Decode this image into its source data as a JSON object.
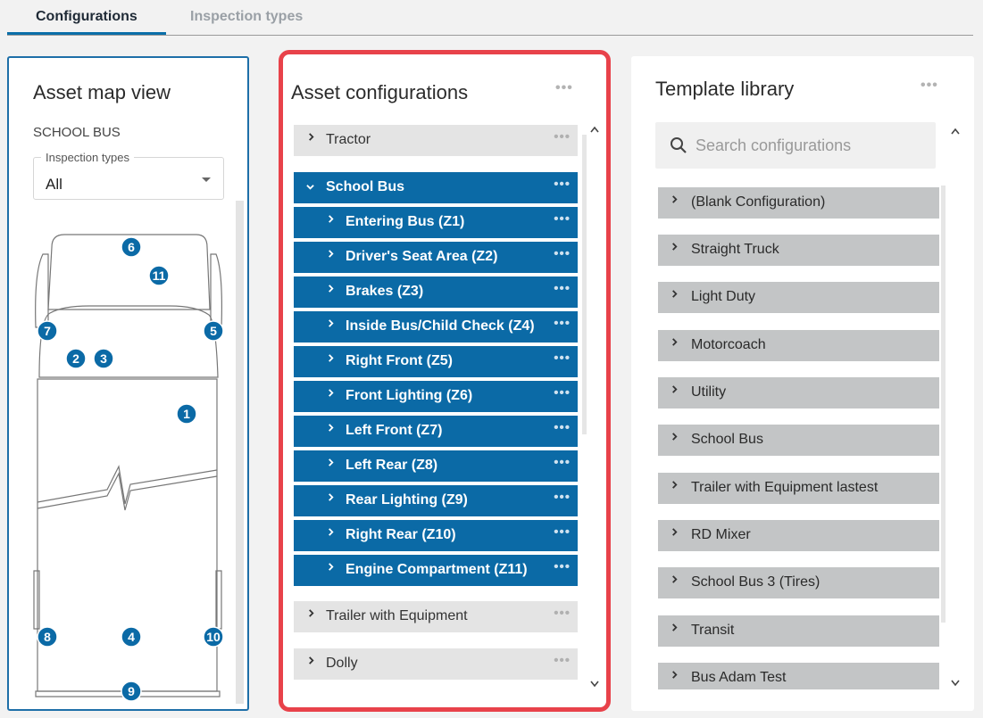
{
  "tabs": [
    {
      "label": "Configurations",
      "active": true
    },
    {
      "label": "Inspection types",
      "active": false
    }
  ],
  "map_view": {
    "title": "Asset map view",
    "asset_name": "SCHOOL BUS",
    "filter": {
      "label": "Inspection types",
      "value": "All"
    },
    "zones": [
      "6",
      "11",
      "7",
      "5",
      "2",
      "3",
      "1",
      "8",
      "4",
      "10",
      "9"
    ]
  },
  "asset_configurations": {
    "title": "Asset configurations",
    "menu_icon": "more-dots-icon",
    "items": [
      {
        "label": "Tractor",
        "expanded": false
      },
      {
        "label": "School Bus",
        "expanded": true,
        "children": [
          {
            "label": "Entering Bus (Z1)"
          },
          {
            "label": "Driver's Seat Area (Z2)"
          },
          {
            "label": "Brakes (Z3)"
          },
          {
            "label": "Inside Bus/Child Check (Z4)"
          },
          {
            "label": "Right Front (Z5)"
          },
          {
            "label": "Front Lighting (Z6)"
          },
          {
            "label": "Left Front (Z7)"
          },
          {
            "label": "Left Rear (Z8)"
          },
          {
            "label": "Rear Lighting (Z9)"
          },
          {
            "label": "Right Rear (Z10)"
          },
          {
            "label": "Engine Compartment (Z11)"
          }
        ]
      },
      {
        "label": "Trailer with Equipment",
        "expanded": false
      },
      {
        "label": "Dolly",
        "expanded": false
      }
    ]
  },
  "template_library": {
    "title": "Template library",
    "search_placeholder": "Search configurations",
    "items": [
      "(Blank Configuration)",
      "Straight Truck",
      "Light Duty",
      "Motorcoach",
      "Utility",
      "School Bus",
      "Trailer with Equipment lastest",
      "RD Mixer",
      "School Bus 3 (Tires)",
      "Transit",
      "Bus Adam Test"
    ]
  },
  "colors": {
    "accent": "#0b6aa6",
    "highlight_border": "#e8424a",
    "row_grey": "#e4e4e4",
    "library_row": "#c3c5c6"
  }
}
